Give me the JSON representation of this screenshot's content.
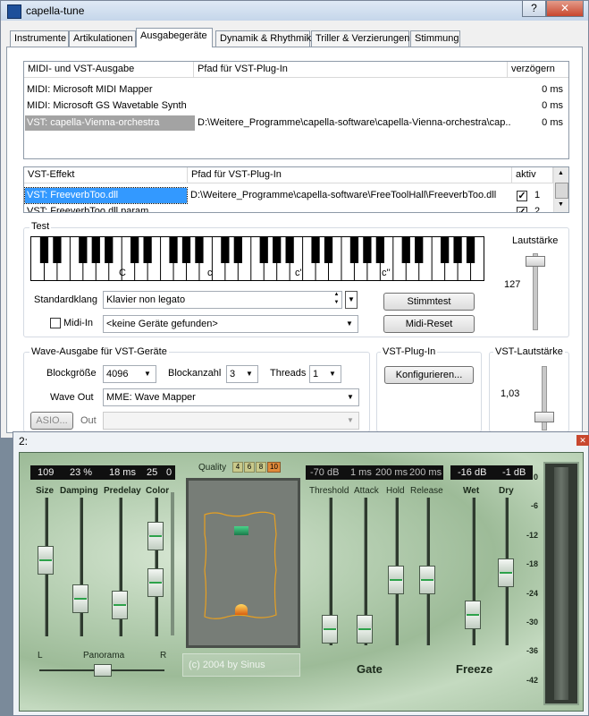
{
  "window": {
    "title": "capella-tune",
    "help_btn": "?",
    "close_btn": "✕"
  },
  "tabs": [
    {
      "label": "Instrumente"
    },
    {
      "label": "Artikulationen"
    },
    {
      "label": "Ausgabegeräte"
    },
    {
      "label": "Dynamik & Rhythmik"
    },
    {
      "label": "Triller & Verzierungen"
    },
    {
      "label": "Stimmung"
    }
  ],
  "output_list": {
    "headers": [
      "MIDI- und VST-Ausgabe",
      "Pfad für VST-Plug-In",
      "verzögern"
    ],
    "rows": [
      {
        "name": "MIDI: Microsoft MIDI Mapper",
        "path": "",
        "delay": "0 ms"
      },
      {
        "name": "MIDI: Microsoft GS Wavetable Synth",
        "path": "",
        "delay": "0 ms"
      },
      {
        "name": "VST: capella-Vienna-orchestra",
        "path": "D:\\Weitere_Programme\\capella-software\\capella-Vienna-orchestra\\cap...",
        "delay": "0 ms"
      }
    ]
  },
  "effect_list": {
    "headers": [
      "VST-Effekt",
      "Pfad für VST-Plug-In",
      "aktiv"
    ],
    "rows": [
      {
        "name": "VST: FreeverbToo.dll",
        "path": "D:\\Weitere_Programme\\capella-software\\FreeToolHall\\FreeverbToo.dll",
        "num": "1"
      },
      {
        "name": "VST: FreeverbToo.dll.param",
        "path": "",
        "num": "2"
      }
    ]
  },
  "test": {
    "title": "Test",
    "key_labels": [
      "C",
      "c",
      "c'",
      "c''"
    ],
    "volume_label": "Lautstärke",
    "volume_value": "127",
    "standard_label": "Standardklang",
    "standard_value": "Klavier non legato",
    "midi_in_label": "Midi-In",
    "midi_in_value": "<keine Geräte gefunden>",
    "stimmtest": "Stimmtest",
    "midi_reset": "Midi-Reset"
  },
  "wave": {
    "title": "Wave-Ausgabe für VST-Geräte",
    "blocksize_label": "Blockgröße",
    "blocksize_value": "4096",
    "blockcount_label": "Blockanzahl",
    "blockcount_value": "3",
    "threads_label": "Threads",
    "threads_value": "1",
    "waveout_label": "Wave Out",
    "waveout_value": "MME: Wave Mapper",
    "asio_btn": "ASIO...",
    "out_label": "Out"
  },
  "vst_plugin": {
    "title": "VST-Plug-In",
    "configure": "Konfigurieren..."
  },
  "vst_volume": {
    "title": "VST-Lautstärke",
    "value": "1,03"
  },
  "plugin_window": {
    "title": "2:",
    "close": "✕",
    "lcd1": [
      "109",
      "23 %",
      "18 ms",
      "25",
      "0"
    ],
    "labels1": [
      "Size",
      "Damping",
      "Predelay",
      "Color"
    ],
    "quality_label": "Quality",
    "quality_options": [
      "4",
      "6",
      "8",
      "10"
    ],
    "lcd2": [
      "-70 dB",
      "1 ms",
      "200 ms",
      "200 ms"
    ],
    "labels2": [
      "Threshold",
      "Attack",
      "Hold",
      "Release"
    ],
    "lcd3": [
      "-16 dB",
      "-1 dB"
    ],
    "labels3": [
      "Wet",
      "Dry"
    ],
    "meter_ticks": [
      "0",
      "-6",
      "-12",
      "-18",
      "-24",
      "-30",
      "-36",
      "-42"
    ],
    "panorama": "Panorama",
    "pan_l": "L",
    "pan_r": "R",
    "copyright": "(c) 2004 by Sinus",
    "gate": "Gate",
    "freeze": "Freeze"
  }
}
